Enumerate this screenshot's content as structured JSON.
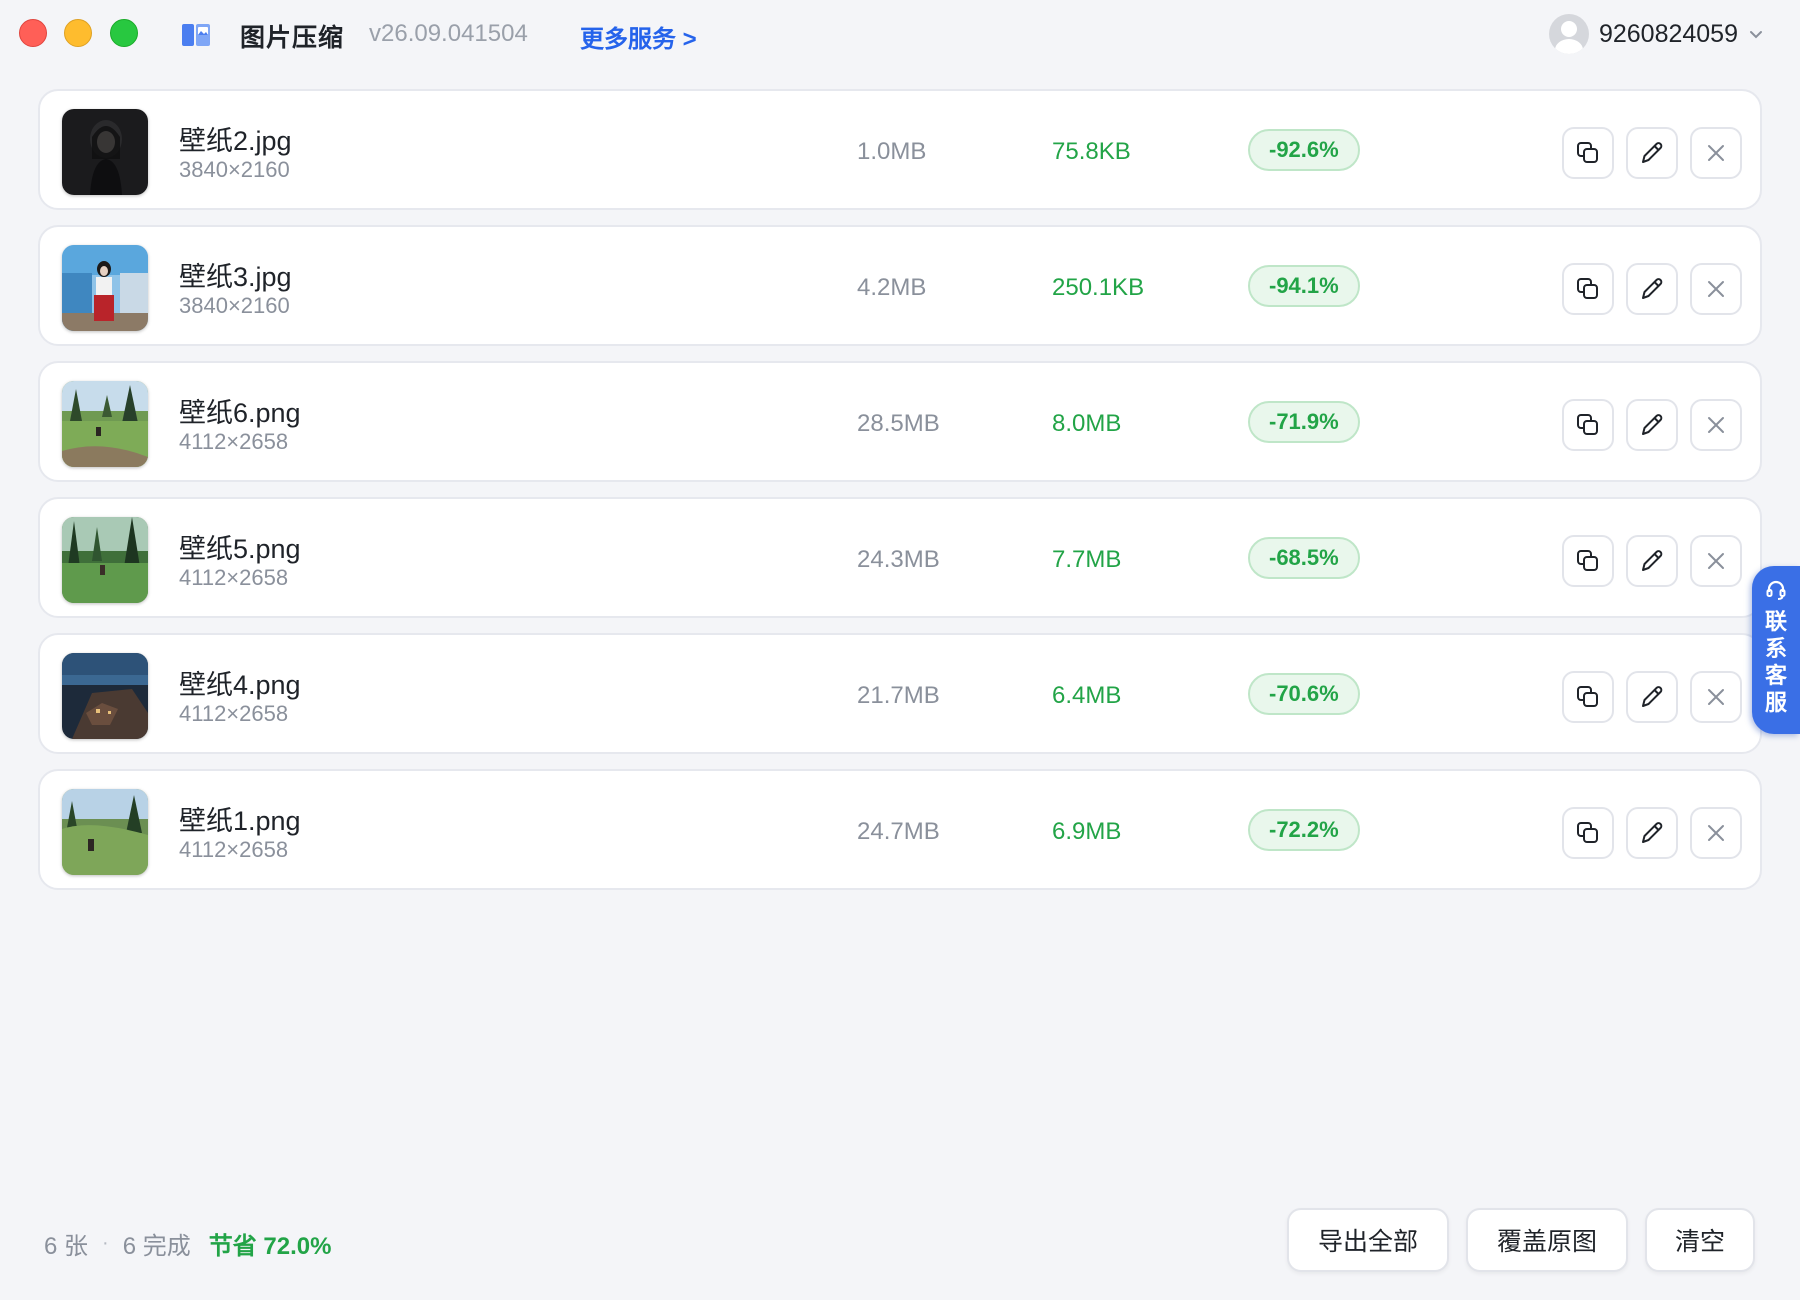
{
  "app": {
    "title": "图片压缩",
    "version": "v26.09.041504",
    "more_services": "更多服务 >",
    "user_id": "9260824059"
  },
  "files": [
    {
      "name": "壁纸2.jpg",
      "dims": "3840×2160",
      "original": "1.0MB",
      "compressed": "75.8KB",
      "ratio": "-92.6%",
      "thumb": "portrait-dark"
    },
    {
      "name": "壁纸3.jpg",
      "dims": "3840×2160",
      "original": "4.2MB",
      "compressed": "250.1KB",
      "ratio": "-94.1%",
      "thumb": "portrait-street"
    },
    {
      "name": "壁纸6.png",
      "dims": "4112×2658",
      "original": "28.5MB",
      "compressed": "8.0MB",
      "ratio": "-71.9%",
      "thumb": "forest-meadow"
    },
    {
      "name": "壁纸5.png",
      "dims": "4112×2658",
      "original": "24.3MB",
      "compressed": "7.7MB",
      "ratio": "-68.5%",
      "thumb": "forest-green"
    },
    {
      "name": "壁纸4.png",
      "dims": "4112×2658",
      "original": "21.7MB",
      "compressed": "6.4MB",
      "ratio": "-70.6%",
      "thumb": "coastal-night"
    },
    {
      "name": "壁纸1.png",
      "dims": "4112×2658",
      "original": "24.7MB",
      "compressed": "6.9MB",
      "ratio": "-72.2%",
      "thumb": "forest-hill"
    }
  ],
  "row_actions": {
    "copy_icon": "copy-icon",
    "edit_icon": "pencil-icon",
    "delete_icon": "close-icon"
  },
  "support_tab": {
    "label": "联系客服",
    "icon": "headset-icon"
  },
  "footer": {
    "count": "6 张",
    "separator": "·",
    "done": "6 完成",
    "saved": "节省 72.0%",
    "export_all": "导出全部",
    "overwrite": "覆盖原图",
    "clear": "清空"
  },
  "colors": {
    "accent": "#2563eb",
    "success": "#22a447",
    "support": "#3a6fe6"
  }
}
